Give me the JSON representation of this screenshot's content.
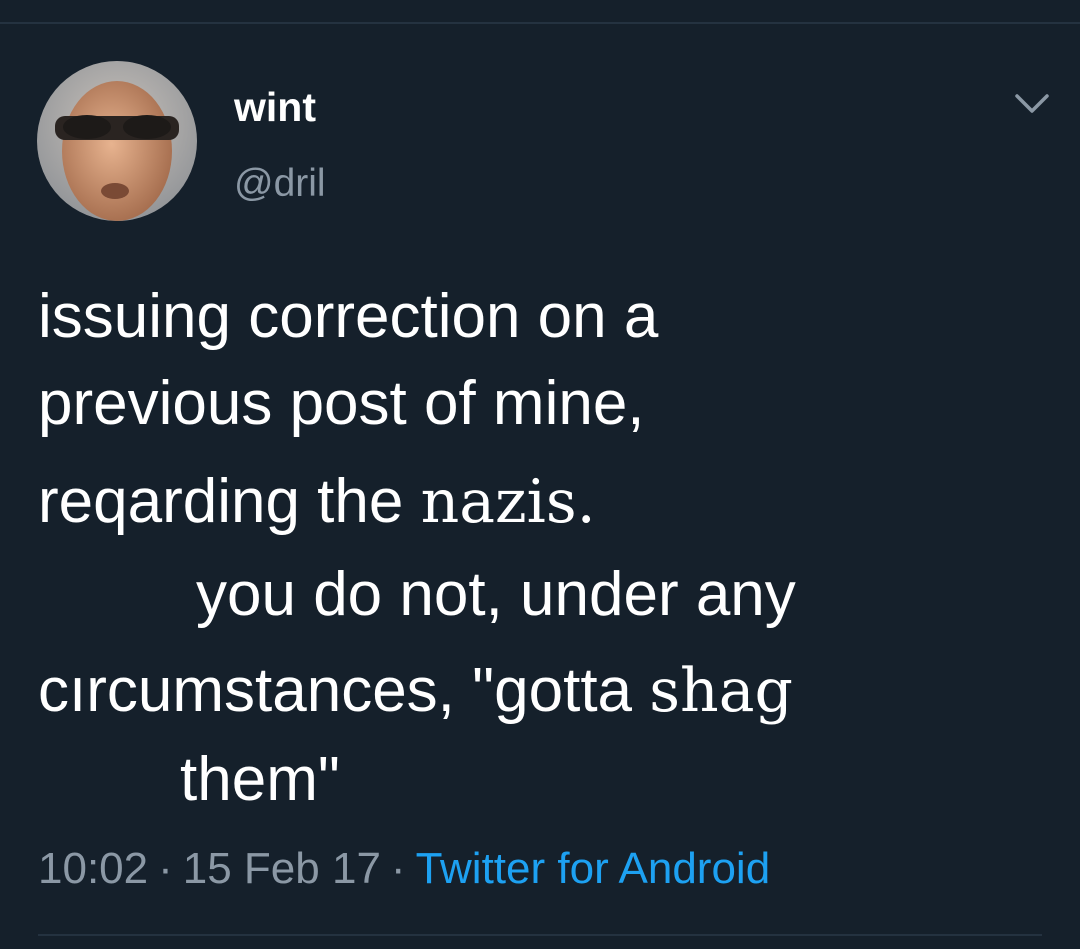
{
  "tweet": {
    "display_name": "wint",
    "handle": "@dril",
    "lines": {
      "l1": "issuing correction on a",
      "l2": "previous post of mine,",
      "l3a": "reqarding the ",
      "l3b": "nazis.",
      "l4": "you do not, under any",
      "l5a": "cırcumstances, \"gotta ",
      "l5b": "shag",
      "l6": "them\""
    },
    "time": "10:02",
    "date": "15 Feb 17",
    "separator": "·",
    "source": "Twitter for Android"
  },
  "icons": {
    "menu": "chevron-down-icon",
    "avatar": "profile-photo"
  },
  "colors": {
    "background": "#15202b",
    "text": "#ffffff",
    "secondary": "#8b98a5",
    "link": "#1da1f2"
  }
}
